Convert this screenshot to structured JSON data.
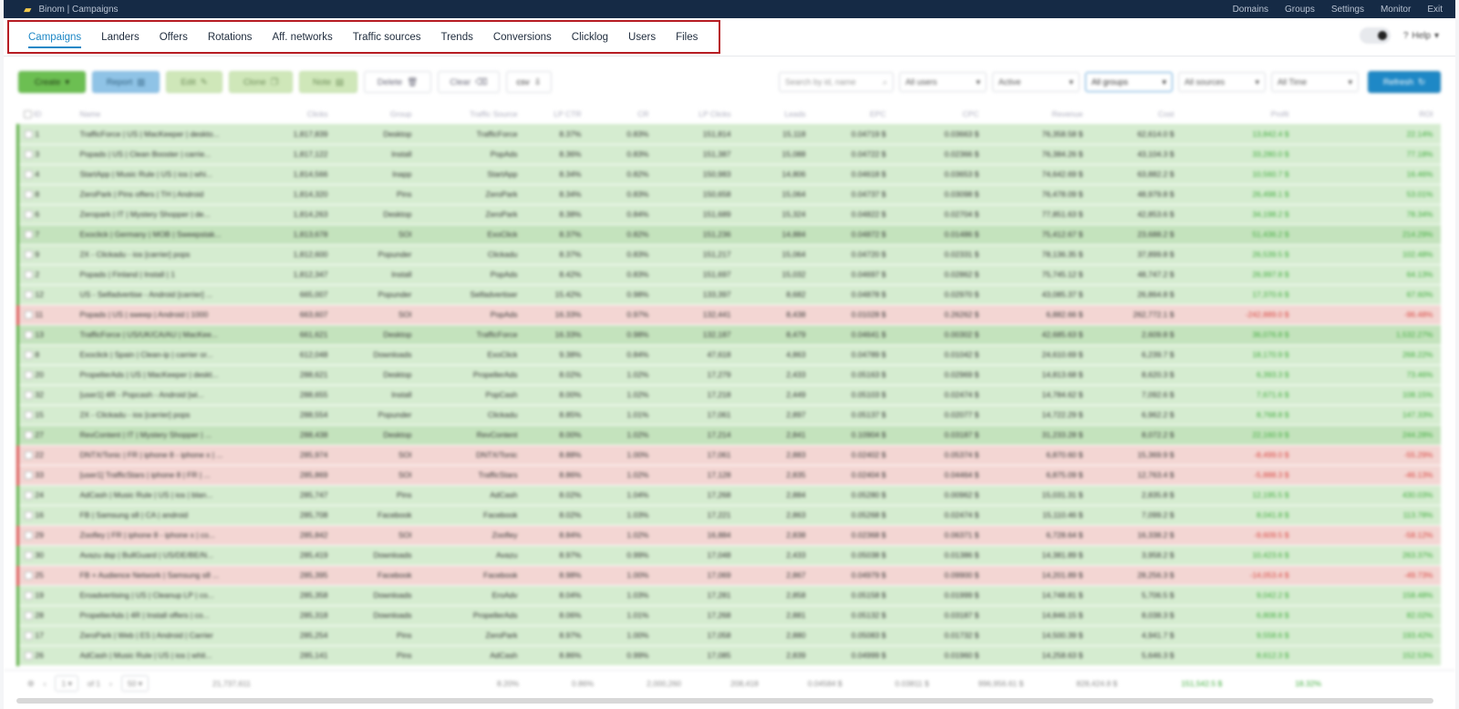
{
  "app": {
    "brand": "Binom | Campaigns",
    "top_links": [
      "Domains",
      "Groups",
      "Settings",
      "Monitor",
      "Exit"
    ]
  },
  "nav": {
    "tabs": [
      "Campaigns",
      "Landers",
      "Offers",
      "Rotations",
      "Aff. networks",
      "Traffic sources",
      "Trends",
      "Conversions",
      "Clicklog",
      "Users",
      "Files"
    ],
    "help": "Help"
  },
  "toolbar": {
    "create": "Create",
    "report": "Report",
    "edit": "Edit",
    "clone": "Clone",
    "note": "Note",
    "delete": "Delete",
    "clear": "Clear",
    "csv": "csv",
    "search_placeholder": "Search by id, name",
    "users": "All users",
    "status": "Active",
    "groups": "All groups",
    "sources": "All sources",
    "time": "All Time",
    "refresh": "Refresh"
  },
  "table": {
    "headers": [
      "ID",
      "Name",
      "Clicks",
      "Group",
      "Traffic Source",
      "LP CTR",
      "CR",
      "LP Clicks",
      "Leads",
      "EPC",
      "CPC",
      "Revenue",
      "Cost",
      "Profit",
      "ROI"
    ],
    "rows": [
      {
        "s": "g",
        "c": [
          "1",
          "TrafficForce | US | MacKeeper | deskto...",
          "1,817,839",
          "Desktop",
          "TrafficForce",
          "8.37%",
          "0.83%",
          "151,814",
          "15,118",
          "0.04719 $",
          "0.03663 $",
          "76,358.58 $",
          "62,614.0 $",
          "13,842.4 $",
          "22.14%"
        ]
      },
      {
        "s": "g",
        "c": [
          "3",
          "Popads | US | Clean Booster | carrie...",
          "1,817,122",
          "Install",
          "PopAds",
          "8.36%",
          "0.83%",
          "151,387",
          "15,088",
          "0.04722 $",
          "0.02366 $",
          "76,384.26 $",
          "43,104.3 $",
          "33,280.0 $",
          "77.18%"
        ]
      },
      {
        "s": "g",
        "c": [
          "4",
          "StartApp | Music Rule | US | ios | whi...",
          "1,814,566",
          "Inapp",
          "StartApp",
          "8.34%",
          "0.82%",
          "150,983",
          "14,806",
          "0.04618 $",
          "0.03653 $",
          "74,642.69 $",
          "63,882.2 $",
          "10,560.7 $",
          "16.46%"
        ]
      },
      {
        "s": "g",
        "c": [
          "8",
          "ZeroPark | Pins offers | TH | Android",
          "1,814,320",
          "Pins",
          "ZeroPark",
          "8.34%",
          "0.83%",
          "150,658",
          "15,064",
          "0.04737 $",
          "0.03098 $",
          "76,478.09 $",
          "48,979.8 $",
          "26,498.1 $",
          "53.01%"
        ]
      },
      {
        "s": "g",
        "c": [
          "6",
          "Zeropark | IT | Mystery Shopper | de...",
          "1,814,263",
          "Desktop",
          "ZeroPark",
          "8.38%",
          "0.84%",
          "151,689",
          "15,324",
          "0.04822 $",
          "0.02704 $",
          "77,851.63 $",
          "42,853.6 $",
          "34,198.2 $",
          "78.34%"
        ]
      },
      {
        "s": "g2",
        "c": [
          "7",
          "Exoclick | Germany | MOB | Sweepstak...",
          "1,813,678",
          "SOI",
          "ExoClick",
          "8.37%",
          "0.82%",
          "151,236",
          "14,884",
          "0.04872 $",
          "0.01486 $",
          "75,412.67 $",
          "23,688.2 $",
          "51,436.2 $",
          "214.29%"
        ]
      },
      {
        "s": "g",
        "c": [
          "9",
          "2X - Clickadu - ios [carrier] pops",
          "1,812,600",
          "Popunder",
          "Clickadu",
          "8.37%",
          "0.83%",
          "151,217",
          "15,064",
          "0.04720 $",
          "0.02331 $",
          "78,136.35 $",
          "37,899.8 $",
          "26,539.5 $",
          "102.48%"
        ]
      },
      {
        "s": "g",
        "c": [
          "2",
          "Popads | Finland | Install | 1",
          "1,812,347",
          "Install",
          "PopAds",
          "8.42%",
          "0.83%",
          "151,697",
          "15,032",
          "0.04697 $",
          "0.02862 $",
          "75,745.12 $",
          "48,747.2 $",
          "26,997.8 $",
          "64.13%"
        ]
      },
      {
        "s": "g",
        "c": [
          "12",
          "US - Selfadvertise - Android [carrier] ...",
          "665,007",
          "Popunder",
          "Selfadvertiser",
          "15.42%",
          "0.98%",
          "133,397",
          "8,682",
          "0.04878 $",
          "0.02970 $",
          "43,085.37 $",
          "26,864.8 $",
          "17,370.6 $",
          "67.60%"
        ]
      },
      {
        "s": "r",
        "c": [
          "11",
          "Popads | US | sweep | Android | 1000",
          "663,607",
          "SOI",
          "PopAds",
          "16.33%",
          "0.97%",
          "132,441",
          "8,438",
          "0.01028 $",
          "0.26262 $",
          "6,882.66 $",
          "262,772.1 $",
          "-242,889.0 $",
          "-96.48%"
        ]
      },
      {
        "s": "g2",
        "c": [
          "13",
          "TrafficForce | US/UK/CA/AU | MacKee...",
          "661,621",
          "Desktop",
          "TrafficForce",
          "16.33%",
          "0.98%",
          "132,187",
          "8,479",
          "0.04641 $",
          "0.00302 $",
          "42,685.63 $",
          "2,609.8 $",
          "36,076.8 $",
          "1,532.27%"
        ]
      },
      {
        "s": "g",
        "c": [
          "8",
          "Exoclick | Spain | Clean-ip | carrier or...",
          "612,048",
          "Downloads",
          "ExoClick",
          "9.38%",
          "0.84%",
          "47,618",
          "4,863",
          "0.04789 $",
          "0.01042 $",
          "24,610.69 $",
          "6,239.7 $",
          "18,170.9 $",
          "268.22%"
        ]
      },
      {
        "s": "g",
        "c": [
          "20",
          "PropellerAds | US | MacKeeper | deskt...",
          "288,621",
          "Desktop",
          "PropellerAds",
          "8.02%",
          "1.02%",
          "17,279",
          "2,433",
          "0.05163 $",
          "0.02969 $",
          "14,813.68 $",
          "8,620.3 $",
          "6,393.3 $",
          "73.46%"
        ]
      },
      {
        "s": "g",
        "c": [
          "32",
          "[user1] 4R - Popcash - Android [wi...",
          "288,655",
          "Install",
          "PopCash",
          "8.00%",
          "1.02%",
          "17,218",
          "2,449",
          "0.05103 $",
          "0.02474 $",
          "14,784.62 $",
          "7,092.6 $",
          "7,671.6 $",
          "108.15%"
        ]
      },
      {
        "s": "g",
        "c": [
          "15",
          "2X - Clickadu - ios [carrier] pops",
          "288,554",
          "Popunder",
          "Clickadu",
          "8.85%",
          "1.01%",
          "17,061",
          "2,897",
          "0.05137 $",
          "0.02077 $",
          "14,722.29 $",
          "6,962.2 $",
          "8,768.8 $",
          "147.33%"
        ]
      },
      {
        "s": "g2",
        "c": [
          "27",
          "RevContent | IT | Mystery Shopper | ...",
          "288,438",
          "Desktop",
          "RevContent",
          "8.00%",
          "1.02%",
          "17,214",
          "2,841",
          "0.10904 $",
          "0.03187 $",
          "31,233.28 $",
          "8,072.2 $",
          "22,160.9 $",
          "244.28%"
        ]
      },
      {
        "s": "r",
        "c": [
          "22",
          "DNTX/Tonic | FR | iphone 8 - iphone x | ...",
          "285,974",
          "SOI",
          "DNTX/Tonic",
          "8.88%",
          "1.00%",
          "17,061",
          "2,883",
          "0.02402 $",
          "0.05374 $",
          "6,870.60 $",
          "15,369.9 $",
          "-8,499.0 $",
          "-55.29%"
        ]
      },
      {
        "s": "r",
        "c": [
          "33",
          "[user1] TrafficStars | iphone 8 | FR | ...",
          "285,869",
          "SOI",
          "TrafficStars",
          "8.86%",
          "1.02%",
          "17,128",
          "2,835",
          "0.02404 $",
          "0.04464 $",
          "6,875.09 $",
          "12,763.4 $",
          "-5,888.3 $",
          "-46.13%"
        ]
      },
      {
        "s": "g",
        "c": [
          "24",
          "AdCash | Music Rule | US | ios | blan...",
          "285,747",
          "Pins",
          "AdCash",
          "8.02%",
          "1.04%",
          "17,268",
          "2,884",
          "0.05280 $",
          "0.00962 $",
          "15,031.31 $",
          "2,835.8 $",
          "12,195.5 $",
          "430.03%"
        ]
      },
      {
        "s": "g",
        "c": [
          "16",
          "FB | Samsung s8 | CA | android",
          "285,708",
          "Facebook",
          "Facebook",
          "8.02%",
          "1.03%",
          "17,221",
          "2,863",
          "0.05268 $",
          "0.02474 $",
          "15,110.46 $",
          "7,099.2 $",
          "8,041.8 $",
          "113.78%"
        ]
      },
      {
        "s": "r",
        "c": [
          "29",
          "Zoofley | FR | iphone 8 - iphone x | co...",
          "285,842",
          "SOI",
          "Zoofley",
          "8.84%",
          "1.02%",
          "16,884",
          "2,838",
          "0.02368 $",
          "0.06371 $",
          "6,728.64 $",
          "16,338.2 $",
          "-9,609.5 $",
          "-58.12%"
        ]
      },
      {
        "s": "g",
        "c": [
          "30",
          "Avazu dsp | BullGuard | US/DE/BE/N...",
          "285,419",
          "Downloads",
          "Avazu",
          "8.97%",
          "0.99%",
          "17,048",
          "2,433",
          "0.05038 $",
          "0.01386 $",
          "14,381.89 $",
          "3,958.2 $",
          "10,423.6 $",
          "263.37%"
        ]
      },
      {
        "s": "r",
        "c": [
          "25",
          "FB + Audience Network | Samsung s8 ...",
          "285,395",
          "Facebook",
          "Facebook",
          "8.98%",
          "1.00%",
          "17,069",
          "2,867",
          "0.04979 $",
          "0.09900 $",
          "14,201.89 $",
          "28,256.3 $",
          "-14,053.4 $",
          "-49.73%"
        ]
      },
      {
        "s": "g",
        "c": [
          "19",
          "Eroadvertising | US | Cleanup LP | co...",
          "285,358",
          "Downloads",
          "EroAdv",
          "8.04%",
          "1.03%",
          "17,281",
          "2,858",
          "0.05158 $",
          "0.01999 $",
          "14,748.81 $",
          "5,706.5 $",
          "9,042.2 $",
          "158.48%"
        ]
      },
      {
        "s": "g",
        "c": [
          "28",
          "PropellerAds | 4R | Install offers | co...",
          "285,318",
          "Downloads",
          "PropellerAds",
          "8.06%",
          "1.01%",
          "17,268",
          "2,881",
          "0.05132 $",
          "0.03187 $",
          "14,846.15 $",
          "8,038.3 $",
          "6,808.8 $",
          "82.02%"
        ]
      },
      {
        "s": "g",
        "c": [
          "17",
          "ZeroPark | Web | ES | Android | Carrier",
          "285,254",
          "Pins",
          "ZeroPark",
          "8.97%",
          "1.00%",
          "17,058",
          "2,880",
          "0.05083 $",
          "0.01732 $",
          "14,500.39 $",
          "4,941.7 $",
          "9,558.6 $",
          "193.42%"
        ]
      },
      {
        "s": "g",
        "c": [
          "26",
          "AdCash | Music Rule | US | ios | whit...",
          "285,141",
          "Pins",
          "AdCash",
          "8.86%",
          "0.99%",
          "17,085",
          "2,839",
          "0.04999 $",
          "0.01960 $",
          "14,258.63 $",
          "5,646.3 $",
          "8,612.3 $",
          "152.53%"
        ]
      }
    ],
    "totals": [
      "21,737,611",
      "8.20%",
      "0.86%",
      "2,000,260",
      "208,418",
      "0.04584 $",
      "0.03811 $",
      "996,956.61 $",
      "828,424.8 $",
      "151,542.5 $",
      "18.32%"
    ]
  },
  "pager": {
    "page": "1",
    "of": "of 1",
    "per_page": "50"
  }
}
